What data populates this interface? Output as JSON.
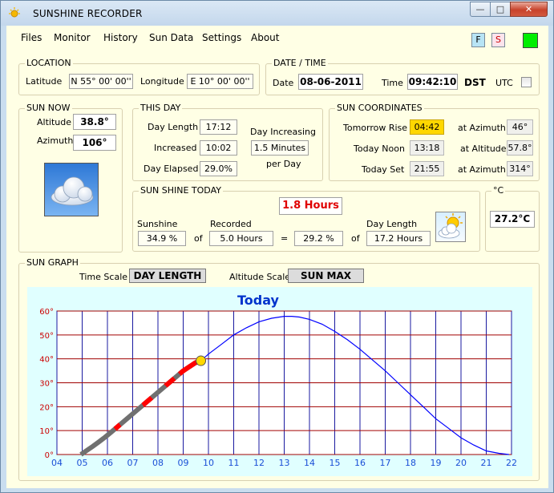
{
  "window": {
    "title": "SUNSHINE RECORDER",
    "min_label": "—",
    "max_label": "□",
    "close_label": "✕"
  },
  "menu": [
    "Files",
    "Monitor",
    "History",
    "Sun Data",
    "Settings",
    "About"
  ],
  "toolbar": {
    "f_label": "F",
    "s_label": "S",
    "status_color": "#00ee00"
  },
  "location": {
    "title": "LOCATION",
    "latitude_label": "Latitude",
    "latitude_value": "N 55° 00' 00''",
    "longitude_label": "Longitude",
    "longitude_value": "E 10° 00' 00''"
  },
  "datetime": {
    "title": "DATE / TIME",
    "date_label": "Date",
    "date_value": "08-06-2011",
    "time_label": "Time",
    "time_value": "09:42:10",
    "dst_label": "DST",
    "utc_label": "UTC",
    "utc_checked": false
  },
  "sun_now": {
    "title": "SUN NOW",
    "altitude_label": "Altitude",
    "altitude_value": "38.8°",
    "azimuth_label": "Azimuth",
    "azimuth_value": "106°",
    "weather_icon": "cloud-icon"
  },
  "this_day": {
    "title": "THIS DAY",
    "day_length_label": "Day Length",
    "day_length_value": "17:12",
    "increased_label": "Increased",
    "increased_value": "10:02",
    "elapsed_label": "Day Elapsed",
    "elapsed_value": "29.0%",
    "increasing_label": "Day Increasing",
    "increasing_value": "1.5 Minutes",
    "per_day_label": "per Day"
  },
  "sun_coordinates": {
    "title": "SUN COORDINATES",
    "rise_label": "Tomorrow Rise",
    "rise_value": "04:42",
    "rise_az_label": "at Azimuth",
    "rise_az_value": "46°",
    "noon_label": "Today Noon",
    "noon_value": "13:18",
    "noon_alt_label": "at Altitude",
    "noon_alt_value": "57.8°",
    "set_label": "Today Set",
    "set_value": "21:55",
    "set_az_label": "at Azimuth",
    "set_az_value": "314°"
  },
  "sunshine_today": {
    "title": "SUN SHINE TODAY",
    "hours_value": "1.8 Hours",
    "sunshine_label": "Sunshine",
    "sunshine_pct": "34.9 %",
    "of_label": "of",
    "recorded_label": "Recorded",
    "recorded_value": "5.0 Hours",
    "eq_label": "=",
    "result_pct": "29.2 %",
    "of2_label": "of",
    "day_length_label": "Day Length",
    "day_length_value": "17.2 Hours",
    "weather_icon": "sun-cloud-icon"
  },
  "temperature": {
    "title": "°C",
    "value": "27.2°C"
  },
  "sun_graph": {
    "title": "SUN GRAPH",
    "time_scale_label": "Time Scale",
    "time_scale_value": "DAY LENGTH",
    "altitude_scale_label": "Altitude Scale",
    "altitude_scale_value": "SUN MAX"
  },
  "chart_data": {
    "type": "line",
    "title": "Today",
    "x_ticks": [
      "04",
      "05",
      "06",
      "07",
      "08",
      "09",
      "10",
      "11",
      "12",
      "13",
      "14",
      "15",
      "16",
      "17",
      "18",
      "19",
      "20",
      "21",
      "22"
    ],
    "y_ticks": [
      "0°",
      "10°",
      "20°",
      "30°",
      "40°",
      "50°",
      "60°"
    ],
    "xlim": [
      4,
      22
    ],
    "ylim": [
      0,
      60
    ],
    "grid": true,
    "sun_path": {
      "x": [
        4.95,
        5.5,
        6,
        6.5,
        7,
        7.5,
        8,
        8.5,
        9,
        9.5,
        9.7,
        10,
        10.5,
        11,
        11.5,
        12,
        12.5,
        13,
        13.3,
        13.6,
        14,
        14.5,
        15,
        15.5,
        16,
        16.5,
        17,
        17.5,
        18,
        18.5,
        19,
        19.5,
        20,
        20.5,
        21,
        21.5,
        21.9
      ],
      "y": [
        0,
        4,
        8,
        12.5,
        17,
        21.5,
        26,
        30.5,
        35,
        38.5,
        39.2,
        42,
        46,
        50,
        53,
        55.5,
        57,
        57.8,
        57.8,
        57.5,
        56.5,
        54.5,
        51.5,
        48,
        44,
        39.5,
        35,
        30,
        25,
        20,
        15,
        11,
        7,
        4,
        1.5,
        0.5,
        0
      ],
      "color": "#0000ff"
    },
    "sunshine_segments": [
      {
        "from": 6.3,
        "to": 6.5,
        "color": "#ff0000"
      },
      {
        "from": 7.4,
        "to": 7.75,
        "color": "#ff0000"
      },
      {
        "from": 8.3,
        "to": 8.65,
        "color": "#ff0000"
      },
      {
        "from": 8.85,
        "to": 9.7,
        "color": "#ff0000"
      }
    ],
    "recorded_color": "#707070",
    "current_point": {
      "x": 9.7,
      "y": 39.2,
      "color": "#ffd700"
    }
  }
}
